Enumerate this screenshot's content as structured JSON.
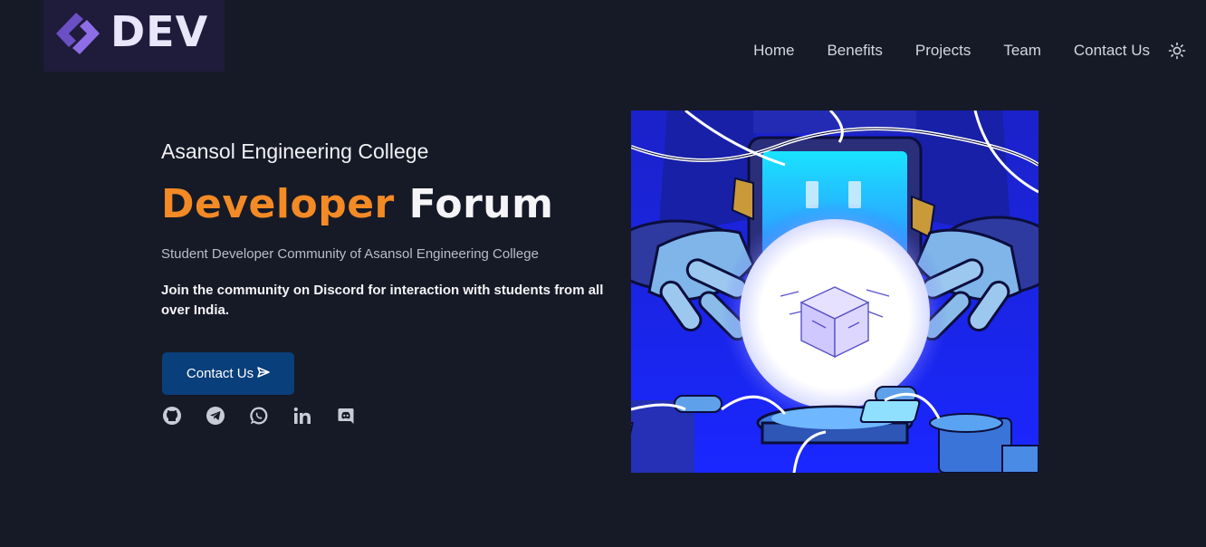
{
  "logo": {
    "text": "DEV",
    "icon": "dev-chevron-logo-icon"
  },
  "nav": {
    "items": [
      "Home",
      "Benefits",
      "Projects",
      "Team",
      "Contact Us"
    ],
    "theme_toggle_icon": "sun-icon"
  },
  "hero": {
    "college": "Asansol Engineering College",
    "title_accent": "Developer",
    "title_rest": "Forum",
    "tagline": "Student Developer Community of Asansol Engineering College",
    "join_text": "Join the community on Discord for interaction with students from all over India.",
    "cta_label": "Contact Us",
    "cta_icon": "send-icon",
    "socials": [
      "github-icon",
      "telegram-icon",
      "whatsapp-icon",
      "linkedin-icon",
      "discord-icon"
    ],
    "illustration": "robot-hands-holding-glowing-orb-with-cube-illustration"
  },
  "colors": {
    "background": "#161a26",
    "accent_orange": "#f38a26",
    "cta_blue": "#093f7a",
    "logo_bg": "#1f1b3b",
    "logo_purple": "#7a5ad6"
  }
}
